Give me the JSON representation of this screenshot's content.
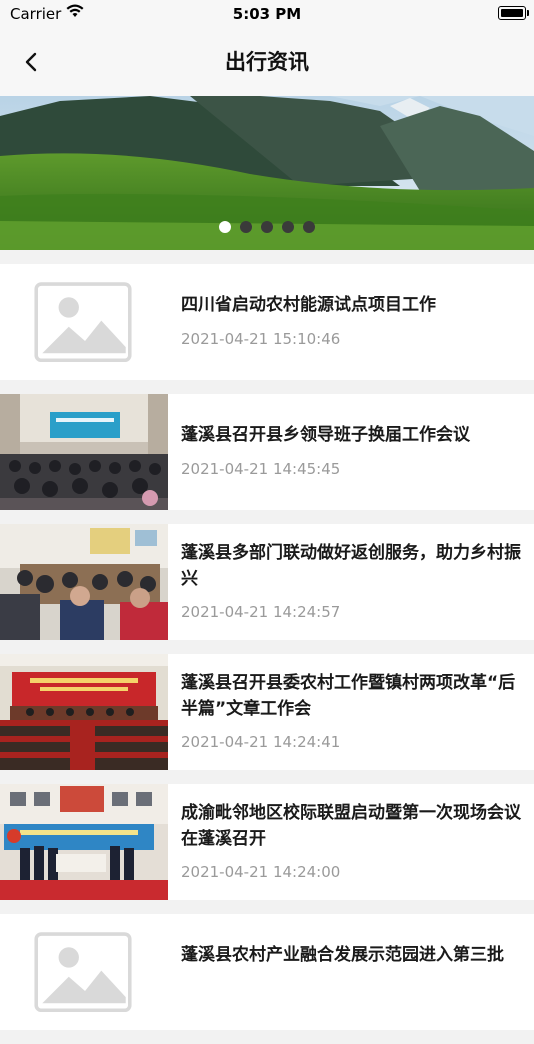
{
  "status_bar": {
    "carrier": "Carrier",
    "time": "5:03 PM"
  },
  "nav": {
    "title": "出行资讯",
    "back_icon": "chevron-left-icon"
  },
  "banner": {
    "slide_count": 5,
    "active_index": 0
  },
  "news": [
    {
      "title": "四川省启动农村能源试点项目工作",
      "time": "2021-04-21 15:10:46",
      "image": "placeholder"
    },
    {
      "title": "蓬溪县召开县乡领导班子换届工作会议",
      "time": "2021-04-21 14:45:45",
      "image": "photo"
    },
    {
      "title": "蓬溪县多部门联动做好返创服务，助力乡村振兴",
      "time": "2021-04-21 14:24:57",
      "image": "photo"
    },
    {
      "title": "蓬溪县召开县委农村工作暨镇村两项改革“后半篇”文章工作会",
      "time": "2021-04-21 14:24:41",
      "image": "photo"
    },
    {
      "title": "成渝毗邻地区校际联盟启动暨第一次现场会议在蓬溪召开",
      "time": "2021-04-21 14:24:00",
      "image": "photo"
    },
    {
      "title": "蓬溪县农村产业融合发展示范园进入第三批",
      "time": "",
      "image": "placeholder"
    }
  ]
}
